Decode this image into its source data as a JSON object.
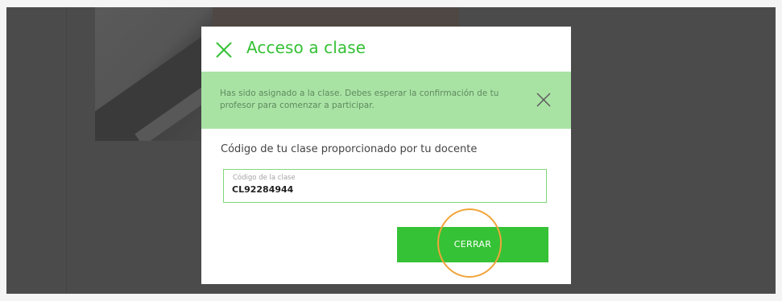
{
  "dialog": {
    "title": "Acceso a clase",
    "close_icon": "close-x-icon",
    "accent_color": "#35c135"
  },
  "alert": {
    "message": "Has sido asignado a la clase. Debes esperar la confirmación de tu profesor para comenzar a participar.",
    "dismiss_icon": "close-x-icon",
    "background_color": "#a9e3a4"
  },
  "form": {
    "caption": "Código de tu clase proporcionado por tu docente",
    "class_code": {
      "label": "Código de la clase",
      "value": "CL92284944"
    }
  },
  "actions": {
    "close_label": "CERRAR",
    "button_color": "#36c236",
    "highlight_color": "#f2a43a"
  }
}
